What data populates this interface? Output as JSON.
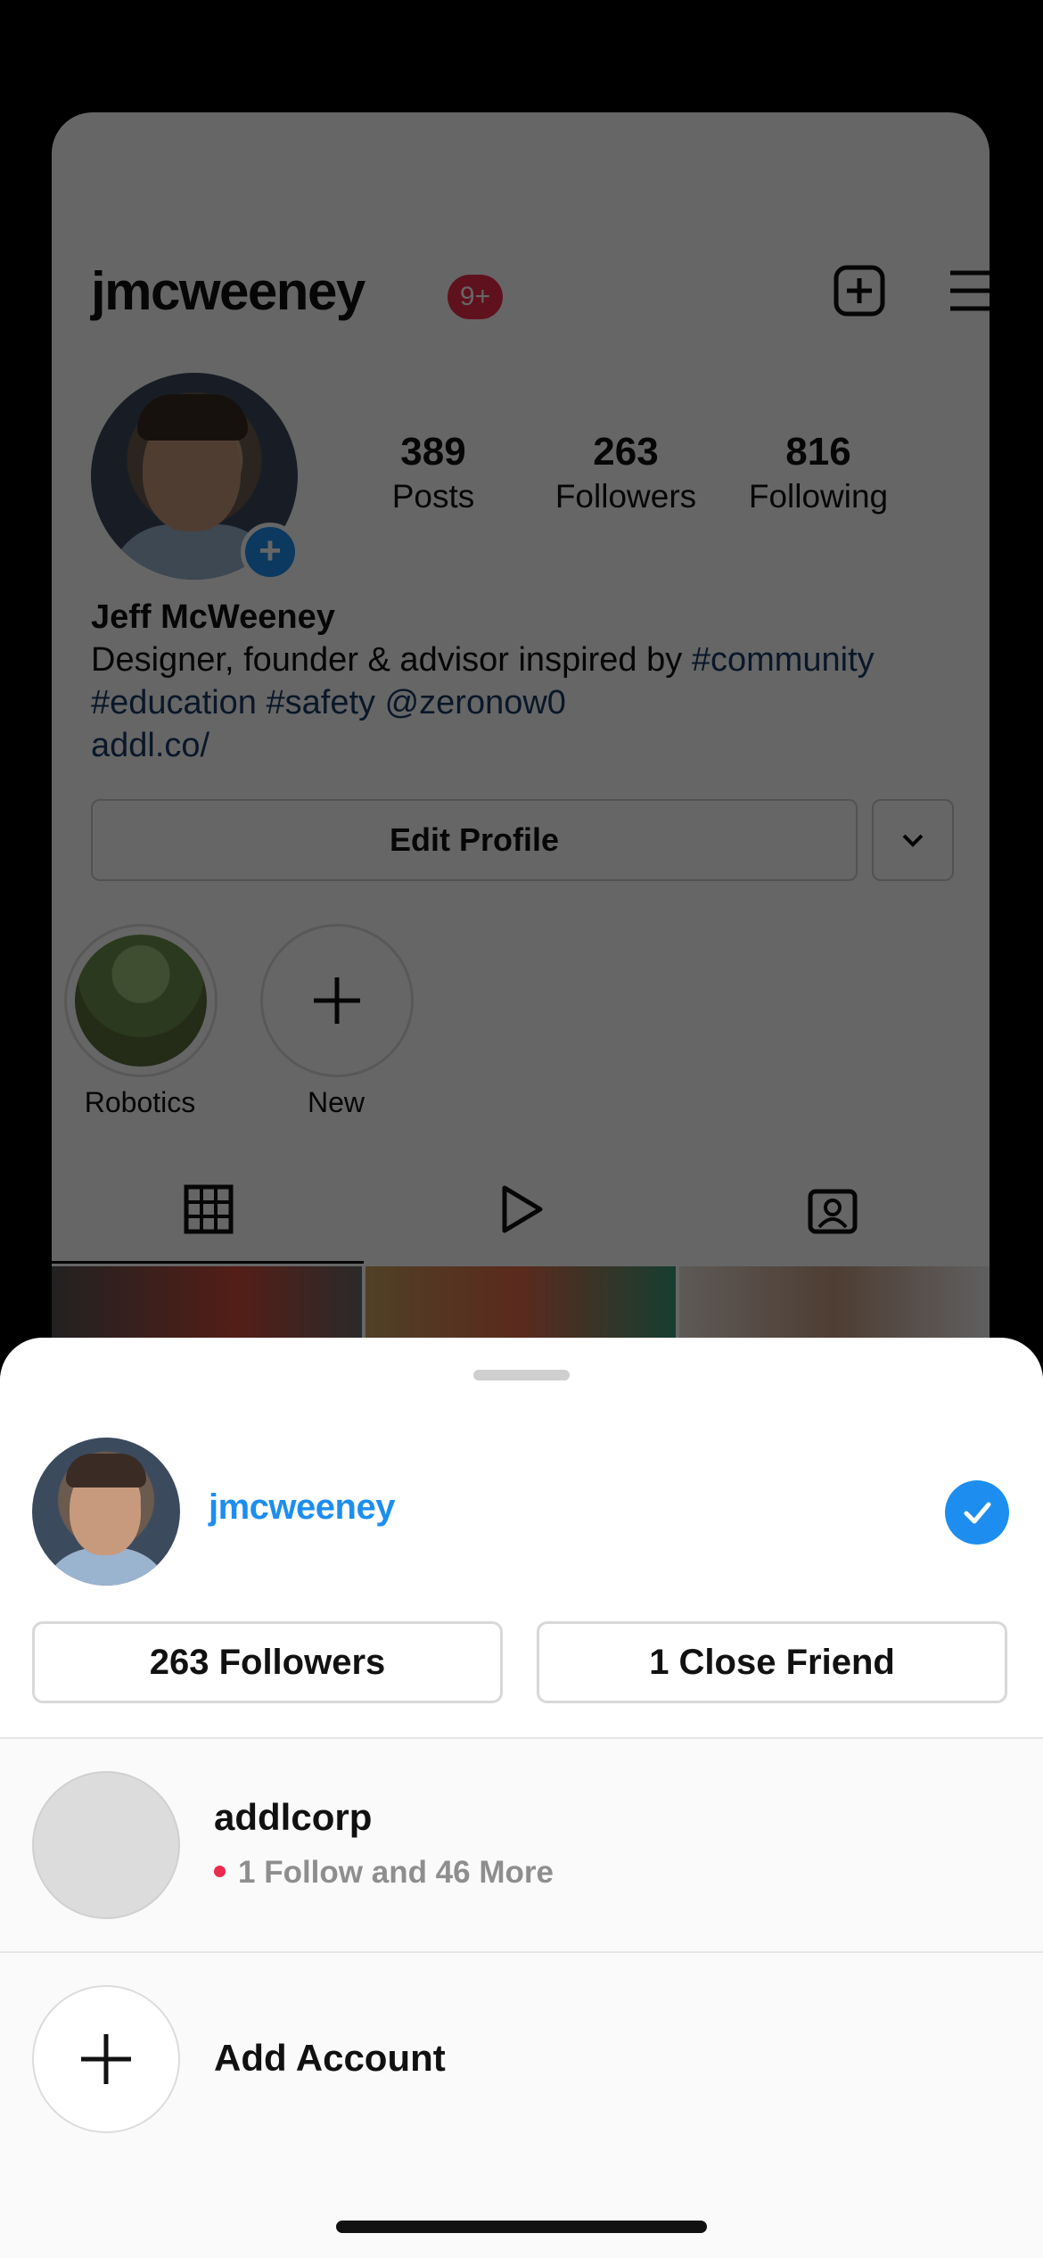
{
  "profile": {
    "username": "jmcweeney",
    "notification_badge": "9+",
    "stats": [
      {
        "value": "389",
        "label": "Posts"
      },
      {
        "value": "263",
        "label": "Followers"
      },
      {
        "value": "816",
        "label": "Following"
      }
    ],
    "full_name": "Jeff McWeeney",
    "bio_text": "Designer, founder & advisor inspired by ",
    "bio_tag_1": "#community",
    "bio_tag_2": "#education",
    "bio_tag_3": "#safety",
    "bio_mention": "@zeronow0",
    "bio_link": "addl.co/",
    "edit_profile_label": "Edit Profile",
    "highlights": [
      {
        "label": "Robotics"
      },
      {
        "label": "New"
      }
    ]
  },
  "account_sheet": {
    "current_account": "jmcweeney",
    "followers_button": "263 Followers",
    "close_friend_button": "1 Close Friend",
    "other_account": {
      "name": "addlcorp",
      "subtitle": "1 Follow and 46 More"
    },
    "add_account_label": "Add Account"
  },
  "colors": {
    "accent": "#1d8ef0",
    "badge": "#ef2b4d",
    "link": "#1b3a66"
  }
}
